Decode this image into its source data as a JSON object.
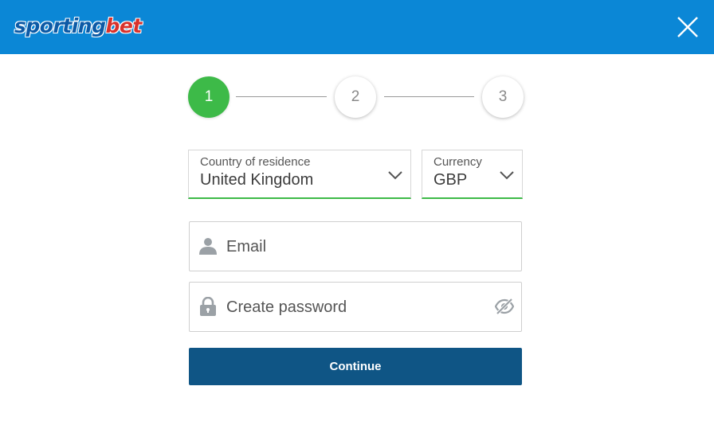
{
  "header": {
    "logo_part1": "sporting",
    "logo_part2": "bet",
    "close_icon": "close-icon",
    "background_color": "#0b87d6"
  },
  "stepper": {
    "steps": [
      "1",
      "2",
      "3"
    ],
    "active_step": 1,
    "active_color": "#3dba48"
  },
  "form": {
    "country": {
      "label": "Country of residence",
      "value": "United Kingdom"
    },
    "currency": {
      "label": "Currency",
      "value": "GBP"
    },
    "email": {
      "placeholder": "Email",
      "icon": "user-icon"
    },
    "password": {
      "placeholder": "Create password",
      "icon": "lock-icon",
      "toggle_icon": "eye-slash-icon"
    },
    "continue_label": "Continue",
    "continue_color": "#0f5585"
  }
}
